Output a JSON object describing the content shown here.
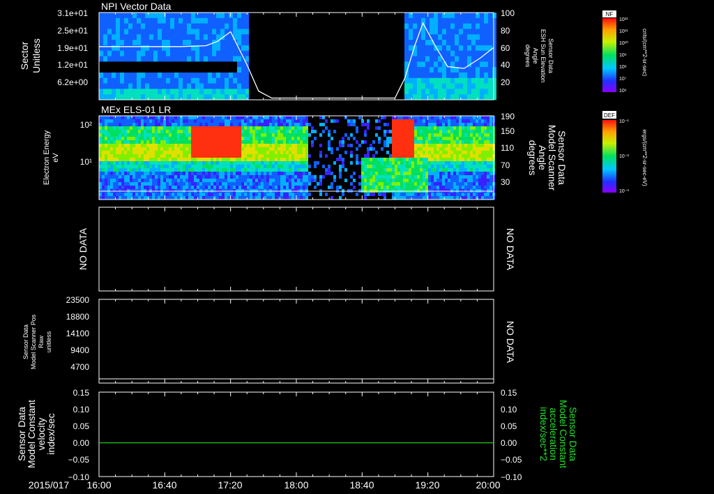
{
  "colors": {
    "background": "#000000",
    "axis": "#ffffff",
    "trace": "#ffffff",
    "zero_line": "#22cc22",
    "right_label_green": "#22e02a"
  },
  "x_axis": {
    "date_label": "2015/017",
    "range": [
      "16:00",
      "20:00"
    ],
    "tick_labels": [
      "16:00",
      "16:40",
      "17:20",
      "18:00",
      "18:40",
      "19:20",
      "20:00"
    ]
  },
  "chart_data": [
    {
      "type": "heatmap",
      "title": "NPI Vector Data",
      "ylabel": [
        "Sector",
        "Unitless"
      ],
      "yticks_left": [
        "3.1e+01",
        "2.5e+01",
        "1.9e+01",
        "1.2e+01",
        "6.2e+00"
      ],
      "ylabel_right": [
        "Sensor Data",
        "ESH Sun Elevation",
        "Angle",
        "degrees"
      ],
      "yticks_right": [
        "100",
        "80",
        "60",
        "40",
        "20"
      ],
      "ylim_right": [
        0,
        100
      ],
      "colorbar": {
        "label": "NF",
        "units": "cnts/(cm**2-sr-sec)",
        "tick_labels": [
          "10¹²",
          "10¹¹",
          "10¹⁰",
          "10⁹",
          "10⁸",
          "10⁷",
          "10⁶"
        ]
      },
      "data_gap": [
        "17:35",
        "19:05"
      ],
      "overlay_series": {
        "name": "ESH Sun Elevation Angle",
        "x": [
          "16:00",
          "16:50",
          "17:05",
          "17:12",
          "17:20",
          "17:30",
          "17:37",
          "17:45",
          "18:00",
          "18:30",
          "19:00",
          "19:06",
          "19:12",
          "19:17",
          "19:25",
          "19:32",
          "19:42",
          "19:52",
          "20:00"
        ],
        "y": [
          61,
          61,
          62,
          67,
          78,
          40,
          10,
          2,
          2,
          2,
          2,
          25,
          62,
          88,
          60,
          38,
          36,
          48,
          60
        ]
      }
    },
    {
      "type": "heatmap",
      "title": "MEx ELS-01 LR",
      "ylabel": [
        "Electron Energy",
        "eV"
      ],
      "yticks_left": [
        "10²",
        "10¹"
      ],
      "ylabel_right": [
        "Sensor Data",
        "Model Scanner",
        "Angle",
        "degrees"
      ],
      "yticks_right": [
        "190",
        "150",
        "110",
        "70",
        "30"
      ],
      "ylim_right": [
        0,
        190
      ],
      "colorbar": {
        "label": "DEF",
        "units": "ergs/(cm**2-sr-sec-eV)",
        "tick_labels": [
          "10⁻¹",
          "10⁻²",
          "10⁻³"
        ]
      },
      "overlay_series": {
        "name": "Model Scanner Angle",
        "x": [
          "16:00",
          "20:00"
        ],
        "y": [
          0,
          0
        ]
      }
    },
    {
      "type": "line",
      "status_left": "NO DATA",
      "status_right": "NO DATA"
    },
    {
      "type": "line",
      "ylabel": [
        "Sensor Data",
        "Model Scanner Pos",
        "Raw",
        "unitless"
      ],
      "yticks_left": [
        "23500",
        "18800",
        "14100",
        "9400",
        "4700"
      ],
      "ylim": [
        0,
        23500
      ],
      "status_right": "NO DATA"
    },
    {
      "type": "line",
      "ylabel": [
        "Sensor Data",
        "Model Constant",
        "velocity",
        "index/sec"
      ],
      "ylabel_right": [
        "Sensor Data",
        "Model Constant",
        "acceleration",
        "index/sec**2"
      ],
      "yticks_left": [
        "0.15",
        "0.10",
        "0.05",
        "0.00",
        "−0.05",
        "−0.10"
      ],
      "yticks_right": [
        "0.15",
        "0.10",
        "0.05",
        "0.00",
        "−0.05",
        "−0.10"
      ],
      "ylim": [
        -0.1,
        0.15
      ],
      "series": [
        {
          "x": [
            "16:00",
            "20:00"
          ],
          "y": [
            0.0,
            0.0
          ]
        }
      ]
    }
  ]
}
